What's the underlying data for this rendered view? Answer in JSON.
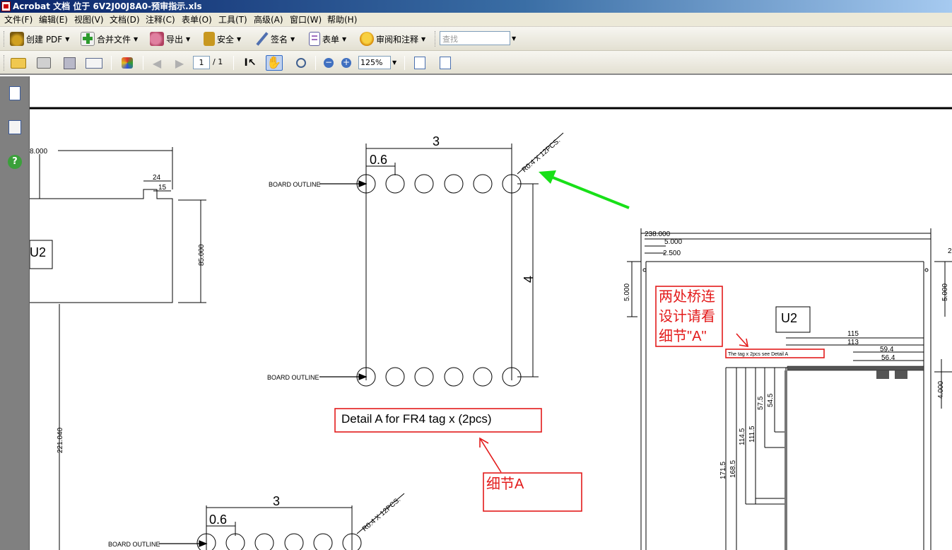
{
  "window": {
    "title": "Acrobat 文档 位于 6V2J00J8A0-预审指示.xls"
  },
  "menu": {
    "items": [
      "文件(F)",
      "编辑(E)",
      "视图(V)",
      "文档(D)",
      "注释(C)",
      "表单(O)",
      "工具(T)",
      "高级(A)",
      "窗口(W)",
      "帮助(H)"
    ]
  },
  "toolbar1": {
    "create_pdf": "创建 PDF",
    "merge": "合并文件",
    "export": "导出",
    "security": "安全",
    "sign": "签名",
    "forms": "表单",
    "review": "审阅和注释",
    "search_placeholder": "查找"
  },
  "toolbar2": {
    "page_current": "1",
    "page_total": "/ 1",
    "zoom": "125%"
  },
  "colors": {
    "annotation_red": "#e31b1b",
    "arrow_green": "#18e018",
    "title_blue": "#0a246a"
  },
  "drawing": {
    "dim_left_top": "8.000",
    "dim_24": "24",
    "dim_15": "15",
    "dim_85": "85.000",
    "label_u2_left": "U2",
    "dim_221": "221.040",
    "board_outline": "BOARD OUTLINE",
    "dim_3": "3",
    "dim_0_6": "0.6",
    "r04_note": "R0.4 X 12PCS.",
    "dim_4": "4",
    "detail_a_label": "Detail A for FR4 tag x (2pcs)",
    "annotation_detail": "细节A",
    "annotation_bridge": [
      "两处桥连",
      "设计请看",
      "细节\"A\""
    ],
    "dim_238": "238.000",
    "dim_5": "5.000",
    "dim_2_5": "2.500",
    "dim_5_left": "5.000",
    "dim_5_right": "5.000",
    "dim_right_edge": "2",
    "label_u2_right": "U2",
    "dim_115": "115",
    "dim_113": "113",
    "dim_59_4": "59.4",
    "dim_56_4": "56.4",
    "tag_note": "The tag x 2pcs see Detail A",
    "dim_4_000": "4.000",
    "dim_57_5": "57.5",
    "dim_54_5": "54.5",
    "dim_114_5": "114.5",
    "dim_111_5": "111.5",
    "dim_171_5": "171.5",
    "dim_168_5": "168.5"
  }
}
